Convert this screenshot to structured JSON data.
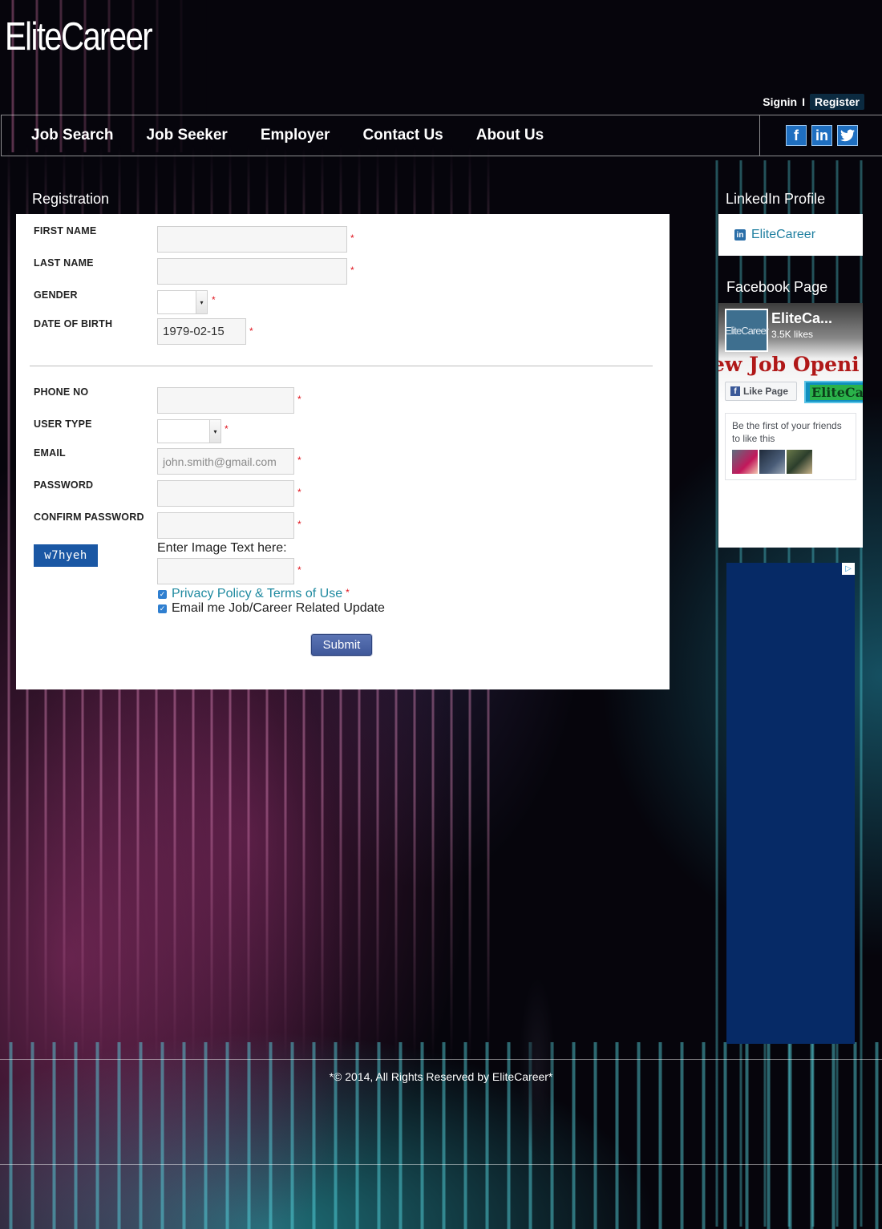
{
  "header": {
    "logo": "EliteCareer",
    "signin": "Signin",
    "separator": "I",
    "register": "Register"
  },
  "nav": {
    "items": [
      "Job Search",
      "Job Seeker",
      "Employer",
      "Contact Us",
      "About Us"
    ],
    "social": [
      {
        "icon": "facebook-icon",
        "glyph": "f"
      },
      {
        "icon": "linkedin-icon",
        "glyph": "in"
      },
      {
        "icon": "twitter-icon",
        "glyph": "t"
      }
    ]
  },
  "registration": {
    "title": "Registration",
    "required_mark": "*",
    "labels": {
      "first_name": "FIRST NAME",
      "last_name": "LAST NAME",
      "gender": "GENDER",
      "dob": "DATE OF BIRTH",
      "phone": "PHONE NO",
      "user_type": "USER TYPE",
      "email": "EMAIL",
      "password": "PASSWORD",
      "confirm_password": "CONFIRM PASSWORD"
    },
    "values": {
      "first_name": "",
      "last_name": "",
      "gender": "",
      "dob": "1979-02-15",
      "phone": "",
      "user_type": "",
      "password": "",
      "confirm_password": "",
      "captcha_answer": ""
    },
    "placeholders": {
      "email": "john.smith@gmail.com"
    },
    "captcha_image_text": "w7hyeh",
    "captcha_prompt": "Enter Image Text here:",
    "privacy_link": "Privacy Policy & Terms of Use",
    "email_updates": "Email me Job/Career Related Update",
    "submit": "Submit"
  },
  "sidebar": {
    "linkedin_title": "LinkedIn Profile",
    "linkedin_link": "EliteCareer",
    "facebook_title": "Facebook Page",
    "fb_page_name": "EliteCa...",
    "fb_thumb_text": "EliteCareer",
    "fb_likes": "3.5K likes",
    "fb_banner": "ew Job Openi",
    "fb_like_button": "Like Page",
    "fb_badge": "EliteCar",
    "fb_friends_text": "Be the first of your friends to like this"
  },
  "footer": {
    "text": "*© 2014, All Rights Reserved by EliteCareer*"
  }
}
